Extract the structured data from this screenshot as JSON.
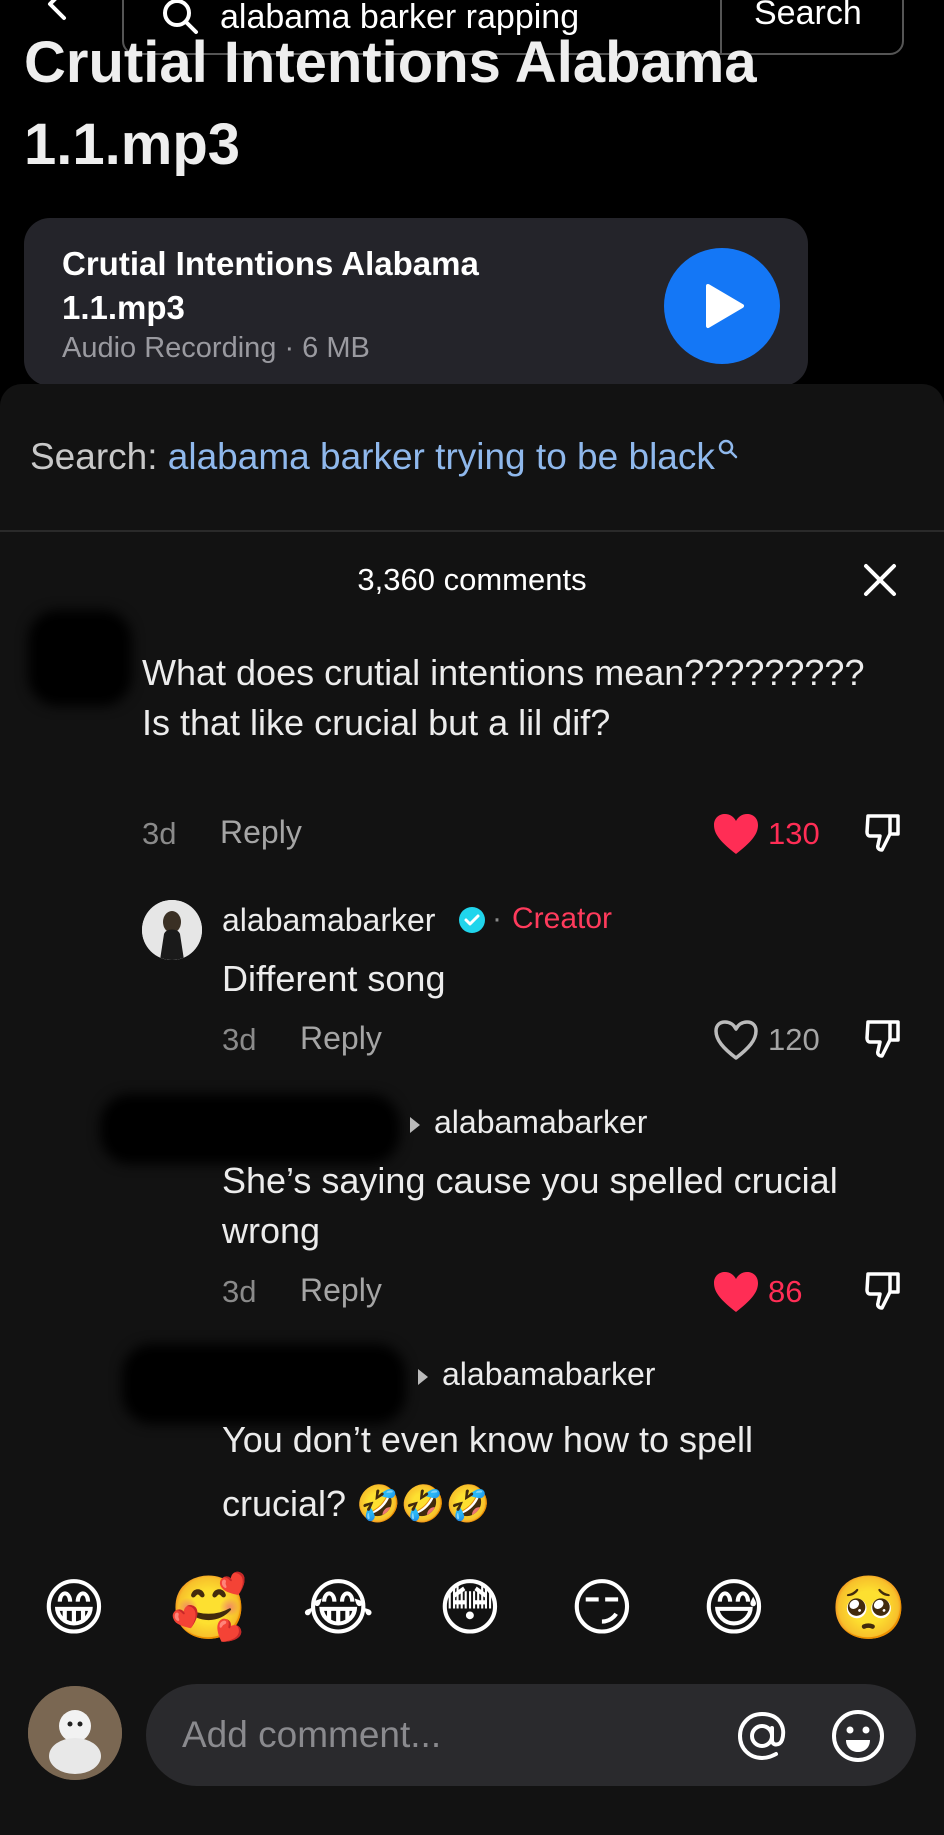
{
  "search": {
    "query": "alabama barker rapping",
    "button": "Search"
  },
  "video": {
    "title": "Crutial Intentions Alabama 1.1.mp3"
  },
  "audio": {
    "name": "Crutial Intentions Alabama 1.1.mp3",
    "meta": "Audio Recording · 6 MB"
  },
  "suggestion": {
    "label": "Search: ",
    "term": "alabama barker trying to be black"
  },
  "comments_header": {
    "count": "3,360 comments"
  },
  "comments": [
    {
      "text": "What does crutial intentions mean????????? Is that like crucial but a lil dif?",
      "age": "3d",
      "reply": "Reply",
      "likes": "130",
      "liked": true
    },
    {
      "user": "alabamabarker",
      "badge": "Creator",
      "separator": "·",
      "text": "Different song",
      "age": "3d",
      "reply": "Reply",
      "likes": "120",
      "liked": false
    },
    {
      "reply_to": "alabamabarker",
      "text": "She’s saying cause you spelled crucial wrong",
      "age": "3d",
      "reply": "Reply",
      "likes": "86",
      "liked": true
    },
    {
      "reply_to": "alabamabarker",
      "text": "You don’t even know how to spell crucial? 🤣🤣🤣"
    }
  ],
  "quick_emojis": [
    "😁",
    "🥰",
    "😂",
    "😳",
    "😏",
    "😅",
    "🥺"
  ],
  "composer": {
    "placeholder": "Add comment..."
  },
  "colors": {
    "accent_blue": "#1477f6",
    "like_red": "#ff2d55",
    "creator_red": "#ff3b5c",
    "link_blue": "#8fb8ec"
  }
}
